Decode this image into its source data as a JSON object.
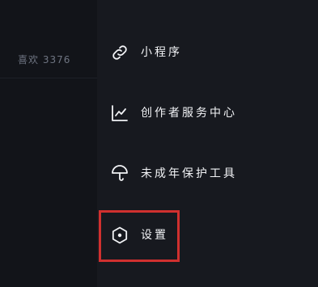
{
  "left_panel": {
    "likes_label": "喜欢 3376"
  },
  "menu": {
    "items": [
      {
        "label": "小程序",
        "icon": "link-icon"
      },
      {
        "label": "创作者服务中心",
        "icon": "chart-icon"
      },
      {
        "label": "未成年保护工具",
        "icon": "umbrella-icon"
      },
      {
        "label": "设置",
        "icon": "settings-hexagon-icon"
      }
    ]
  },
  "colors": {
    "background": "#16181d",
    "left_panel": "#121419",
    "text": "#f2f3f6",
    "highlight": "#d0302f"
  }
}
